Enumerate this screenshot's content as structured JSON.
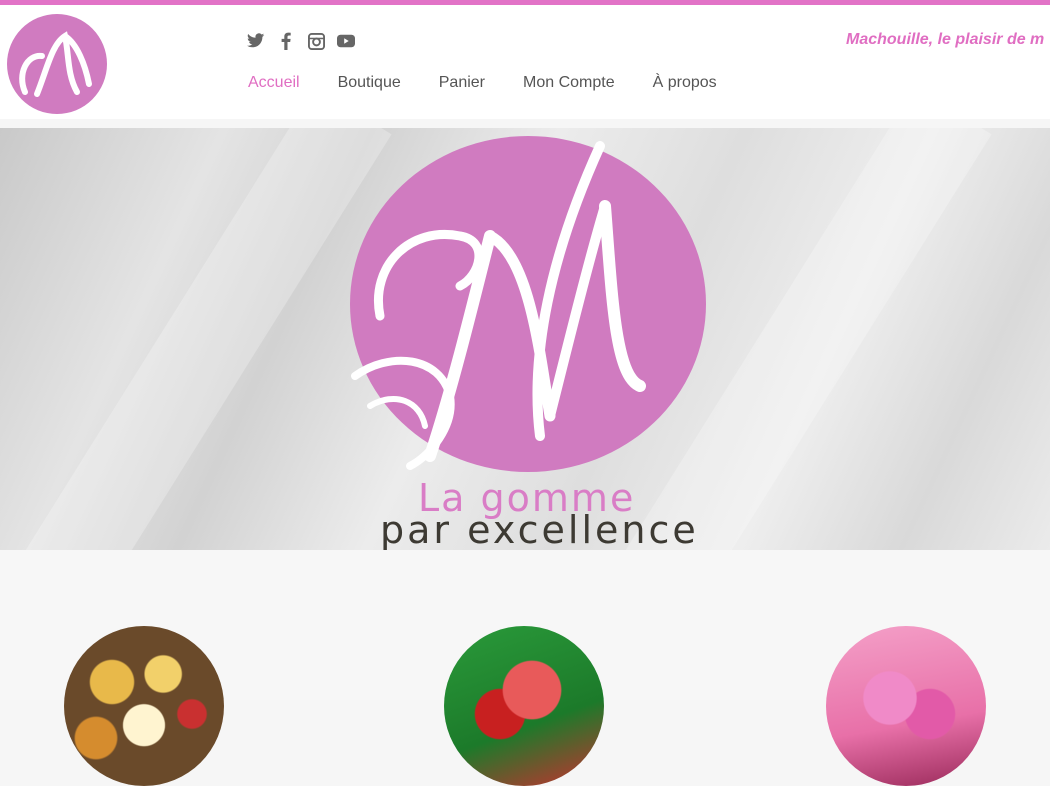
{
  "brand": {
    "name": "Machouille",
    "accent": "#e273c7",
    "logo_color": "#d07bc0"
  },
  "header": {
    "social": [
      "twitter-icon",
      "facebook-icon",
      "instagram-icon",
      "youtube-icon"
    ],
    "tagline": "Machouille, le plaisir de m"
  },
  "nav": {
    "items": [
      {
        "label": "Accueil",
        "active": true
      },
      {
        "label": "Boutique"
      },
      {
        "label": "Panier"
      },
      {
        "label": "Mon Compte"
      },
      {
        "label": "À propos"
      }
    ]
  },
  "hero": {
    "line1": "La gomme",
    "line2": "par excellence"
  },
  "products": [
    {
      "name": "gummy-candies-image"
    },
    {
      "name": "red-candy-image"
    },
    {
      "name": "pink-letters-image"
    }
  ]
}
